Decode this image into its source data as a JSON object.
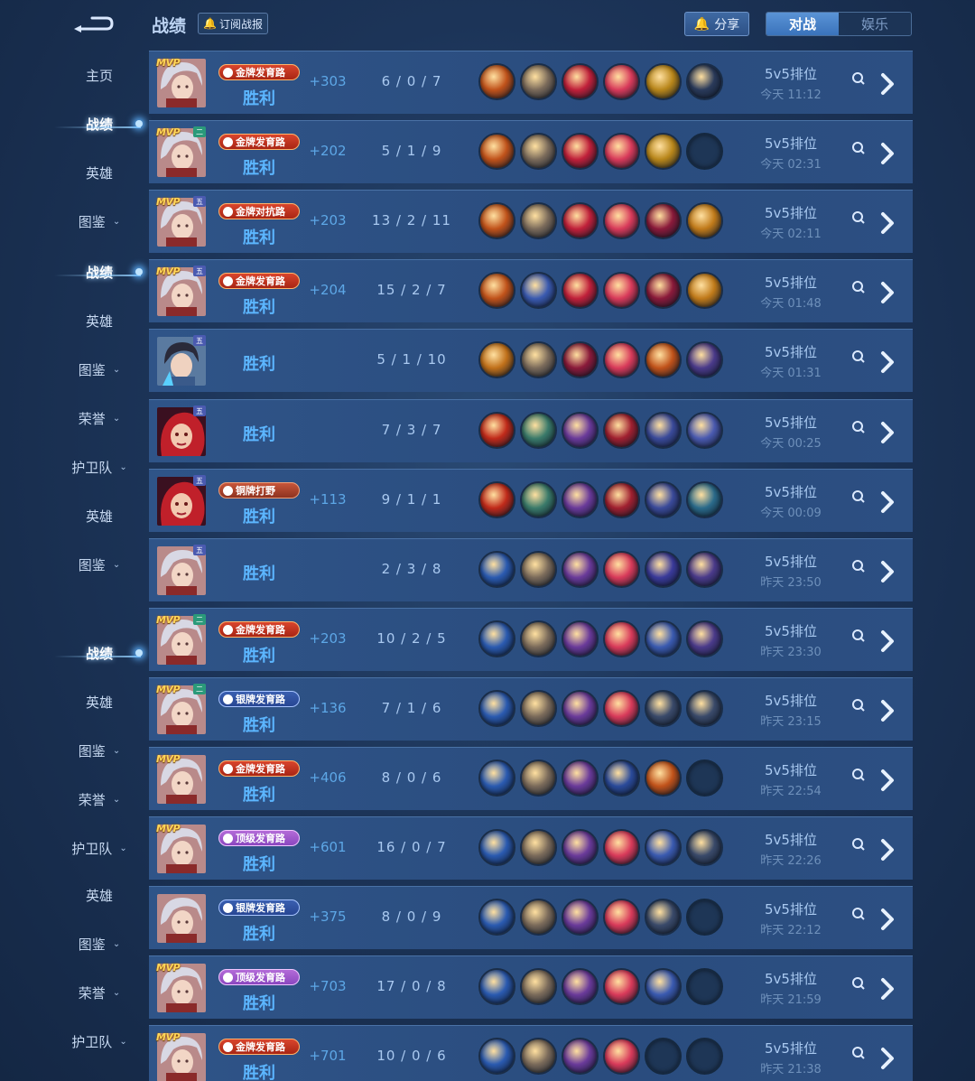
{
  "header": {
    "title": "战绩",
    "subscribe_label": "订阅战报",
    "share_label": "分享",
    "tabs": [
      {
        "label": "对战",
        "active": true
      },
      {
        "label": "娱乐",
        "active": false
      }
    ]
  },
  "sidebar": {
    "items": [
      {
        "label": "主页",
        "chevron": false,
        "active": false
      },
      {
        "label": "战绩",
        "chevron": false,
        "active": true
      },
      {
        "label": "英雄",
        "chevron": false,
        "active": false
      },
      {
        "label": "图鉴",
        "chevron": true,
        "active": false
      },
      {
        "label": "战绩",
        "chevron": false,
        "active": true
      },
      {
        "label": "英雄",
        "chevron": false,
        "active": false
      },
      {
        "label": "图鉴",
        "chevron": true,
        "active": false
      },
      {
        "label": "荣誉",
        "chevron": true,
        "active": false
      },
      {
        "label": "护卫队",
        "chevron": true,
        "active": false
      },
      {
        "label": "英雄",
        "chevron": false,
        "active": false
      },
      {
        "label": "图鉴",
        "chevron": true,
        "active": false
      },
      {
        "label": "战绩",
        "chevron": false,
        "active": true
      },
      {
        "label": "英雄",
        "chevron": false,
        "active": false
      },
      {
        "label": "图鉴",
        "chevron": true,
        "active": false
      },
      {
        "label": "荣誉",
        "chevron": true,
        "active": false
      },
      {
        "label": "护卫队",
        "chevron": true,
        "active": false
      },
      {
        "label": "英雄",
        "chevron": false,
        "active": false
      },
      {
        "label": "图鉴",
        "chevron": true,
        "active": false
      },
      {
        "label": "荣誉",
        "chevron": true,
        "active": false
      },
      {
        "label": "护卫队",
        "chevron": true,
        "active": false
      }
    ]
  },
  "colors": {
    "accent_blue": "#5cb6ff",
    "gold_badge": "#d8452d",
    "silver_badge": "#3a5fb0",
    "top_badge": "#b36bd8"
  },
  "matches": [
    {
      "hero": "silver-hair",
      "mvp": "MVP",
      "rank_tag": "",
      "badge": "金牌发育路",
      "badge_type": "gold",
      "result": "胜利",
      "score": "+303",
      "kda": "6 / 0 / 7",
      "mode": "5v5排位",
      "time": "今天 11:12",
      "items": [
        "#c0521a",
        "#7a6a5a",
        "#c0203a",
        "#d83a5a",
        "#b8861a",
        "#2a3a5a"
      ]
    },
    {
      "hero": "silver-hair",
      "mvp": "MVP",
      "rank_tag": "二",
      "badge": "金牌发育路",
      "badge_type": "gold",
      "result": "胜利",
      "score": "+202",
      "kda": "5 / 1 / 9",
      "mode": "5v5排位",
      "time": "今天 02:31",
      "items": [
        "#c0521a",
        "#7a6a5a",
        "#c0203a",
        "#d83a5a",
        "#b8861a",
        ""
      ]
    },
    {
      "hero": "silver-hair",
      "mvp": "MVP",
      "rank_tag": "五",
      "badge": "金牌对抗路",
      "badge_type": "gold",
      "result": "胜利",
      "score": "+203",
      "kda": "13 / 2 / 11",
      "mode": "5v5排位",
      "time": "今天 02:11",
      "items": [
        "#c0521a",
        "#7a6a5a",
        "#c0203a",
        "#d83a5a",
        "#8a1a3a",
        "#c07a1a"
      ]
    },
    {
      "hero": "silver-hair",
      "mvp": "MVP",
      "rank_tag": "五",
      "badge": "金牌发育路",
      "badge_type": "gold",
      "result": "胜利",
      "score": "+204",
      "kda": "15 / 2 / 7",
      "mode": "5v5排位",
      "time": "今天 01:48",
      "items": [
        "#c0521a",
        "#3a5ab0",
        "#c0203a",
        "#d83a5a",
        "#8a1a3a",
        "#c07a1a"
      ]
    },
    {
      "hero": "dark-hair",
      "mvp": "",
      "rank_tag": "五",
      "badge": "",
      "badge_type": "",
      "result": "胜利",
      "score": "",
      "kda": "5 / 1 / 10",
      "mode": "5v5排位",
      "time": "今天 01:31",
      "items": [
        "#c0701a",
        "#7a6a5a",
        "#8a1a3a",
        "#d83a5a",
        "#c0521a",
        "#4a3a8a"
      ]
    },
    {
      "hero": "red-hair",
      "mvp": "",
      "rank_tag": "五",
      "badge": "",
      "badge_type": "",
      "result": "胜利",
      "score": "",
      "kda": "7 / 3 / 7",
      "mode": "5v5排位",
      "time": "今天 00:25",
      "items": [
        "#c02a1a",
        "#3a7a6a",
        "#6a3a9a",
        "#a02030",
        "#3a4a9a",
        "#4a5ab0"
      ]
    },
    {
      "hero": "red-hair",
      "mvp": "",
      "rank_tag": "五",
      "badge": "铜牌打野",
      "badge_type": "bronze",
      "result": "胜利",
      "score": "+113",
      "kda": "9 / 1 / 1",
      "mode": "5v5排位",
      "time": "今天 00:09",
      "items": [
        "#c02a1a",
        "#3a7a6a",
        "#6a3a9a",
        "#a02030",
        "#3a4a9a",
        "#2a6a8a"
      ]
    },
    {
      "hero": "silver-hair",
      "mvp": "",
      "rank_tag": "五",
      "badge": "",
      "badge_type": "",
      "result": "胜利",
      "score": "",
      "kda": "2 / 3 / 8",
      "mode": "5v5排位",
      "time": "昨天 23:50",
      "items": [
        "#2a5ab0",
        "#7a6a5a",
        "#6a3a9a",
        "#d83a5a",
        "#3a3a9a",
        "#4a3a8a"
      ]
    },
    {
      "hero": "silver-hair",
      "mvp": "MVP",
      "rank_tag": "二",
      "badge": "金牌发育路",
      "badge_type": "gold",
      "result": "胜利",
      "score": "+203",
      "kda": "10 / 2 / 5",
      "mode": "5v5排位",
      "time": "昨天 23:30",
      "items": [
        "#2a5ab0",
        "#7a6a5a",
        "#6a3a9a",
        "#d83a5a",
        "#3a5ab0",
        "#4a3a8a"
      ]
    },
    {
      "hero": "silver-hair",
      "mvp": "MVP",
      "rank_tag": "二",
      "badge": "银牌发育路",
      "badge_type": "silver",
      "result": "胜利",
      "score": "+136",
      "kda": "7 / 1 / 6",
      "mode": "5v5排位",
      "time": "昨天 23:15",
      "items": [
        "#2a5ab0",
        "#7a6a5a",
        "#6a3a9a",
        "#d83a5a",
        "#3a4a6a",
        "#3a4a6a"
      ]
    },
    {
      "hero": "silver-hair",
      "mvp": "MVP",
      "rank_tag": "",
      "badge": "金牌发育路",
      "badge_type": "gold",
      "result": "胜利",
      "score": "+406",
      "kda": "8 / 0 / 6",
      "mode": "5v5排位",
      "time": "昨天 22:54",
      "items": [
        "#2a5ab0",
        "#7a6a5a",
        "#6a3a9a",
        "#2a4a9a",
        "#c0521a",
        ""
      ]
    },
    {
      "hero": "silver-hair",
      "mvp": "MVP",
      "rank_tag": "",
      "badge": "顶级发育路",
      "badge_type": "top",
      "result": "胜利",
      "score": "+601",
      "kda": "16 / 0 / 7",
      "mode": "5v5排位",
      "time": "昨天 22:26",
      "items": [
        "#2a5ab0",
        "#7a6a5a",
        "#6a3a9a",
        "#d83a5a",
        "#3a5ab0",
        "#3a4a6a"
      ]
    },
    {
      "hero": "silver-hair",
      "mvp": "",
      "rank_tag": "",
      "badge": "银牌发育路",
      "badge_type": "silver",
      "result": "胜利",
      "score": "+375",
      "kda": "8 / 0 / 9",
      "mode": "5v5排位",
      "time": "昨天 22:12",
      "items": [
        "#2a5ab0",
        "#7a6a5a",
        "#6a3a9a",
        "#d83a5a",
        "#3a4a6a",
        ""
      ]
    },
    {
      "hero": "silver-hair",
      "mvp": "MVP",
      "rank_tag": "",
      "badge": "顶级发育路",
      "badge_type": "top",
      "result": "胜利",
      "score": "+703",
      "kda": "17 / 0 / 8",
      "mode": "5v5排位",
      "time": "昨天 21:59",
      "items": [
        "#2a5ab0",
        "#7a6a5a",
        "#6a3a9a",
        "#d83a5a",
        "#3a5ab0",
        ""
      ]
    },
    {
      "hero": "silver-hair",
      "mvp": "MVP",
      "rank_tag": "",
      "badge": "金牌发育路",
      "badge_type": "gold",
      "result": "胜利",
      "score": "+701",
      "kda": "10 / 0 / 6",
      "mode": "5v5排位",
      "time": "昨天 21:38",
      "items": [
        "#2a5ab0",
        "#7a6a5a",
        "#6a3a9a",
        "#d83a5a",
        "",
        ""
      ]
    }
  ]
}
